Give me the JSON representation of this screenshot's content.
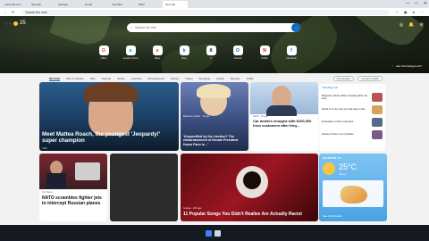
{
  "browser": {
    "tabs": [
      {
        "label": "microsoft.com"
      },
      {
        "label": "New tab"
      },
      {
        "label": "Settings"
      },
      {
        "label": "Gmail"
      },
      {
        "label": "YouTube"
      },
      {
        "label": "MSN"
      },
      {
        "label": "New tab"
      }
    ],
    "active_tab_index": 6,
    "address": "Search the web",
    "window_controls": [
      "—",
      "□",
      "✕"
    ]
  },
  "hero": {
    "weather_temp": "25",
    "search_placeholder": "Search the web",
    "shortcuts": [
      {
        "label": "Office",
        "glyph": "O",
        "color": "#d83b01"
      },
      {
        "label": "Amazon Prime",
        "glyph": "a",
        "color": "#00a8e1"
      },
      {
        "label": "eBay",
        "glyph": "e",
        "color": "#e53238"
      },
      {
        "label": "Bing",
        "glyph": "b",
        "color": "#0f6cbd"
      },
      {
        "label": "X",
        "glyph": "X",
        "color": "#000000"
      },
      {
        "label": "Outlook",
        "glyph": "O",
        "color": "#0f6cbd"
      },
      {
        "label": "Netflix",
        "glyph": "N",
        "color": "#e50914"
      },
      {
        "label": "Facebook",
        "glyph": "f",
        "color": "#1877f2"
      }
    ],
    "like_background": "Like this background?"
  },
  "feed": {
    "categories": [
      "My Feed",
      "War in Ukraine",
      "Play",
      "Gaming",
      "Sports",
      "Learning",
      "Entertainment",
      "Money",
      "Travel",
      "Shopping",
      "Health",
      "Recipes",
      "Traffic"
    ],
    "personalize": "Personalize",
    "content_visible": "Content visible",
    "cards": {
      "main_title": "Meet Mattea Roach, the youngest 'Jeopardy!' super champion",
      "main_source": "CNN",
      "card2_source": "Business Insider · 1h ago",
      "card2_title": "'Unspecified by the election? The embarrassment of Senate President Karen Fann is...'",
      "card3_source": "Patch · 3h ago",
      "card3_title": "Car dealers charged with $100,000 from customers after they...",
      "nato_title": "NATO scrambles fighter jets to intercept Russian planes",
      "nato_source": "Fox News",
      "pop_title": "11 Popular Songs You Didn't Realize Are Actually Racist",
      "pop_source": "Grunge · 22h ago"
    },
    "trending_header": "Trending now",
    "trending": [
      "Bodycam shows officer shooting after car stop",
      "Relief is on the way as heat wave ends",
      "Evacuation orders in Europe",
      "Houston Storm Live Updates"
    ],
    "weather_card": {
      "location": "HOUSTON, TX",
      "temp": "25°C",
      "desc": "Sunny",
      "forecast_link": "See full forecast"
    }
  },
  "colors": {
    "accent": "#0f6cbd",
    "feed_bg": "#f2f2f2"
  }
}
